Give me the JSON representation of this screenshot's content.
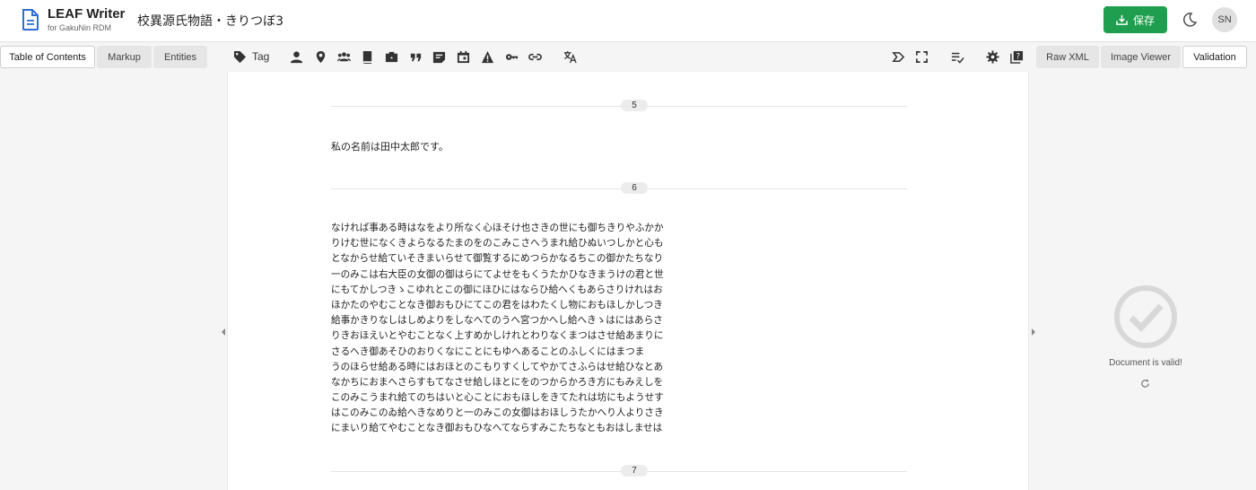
{
  "header": {
    "app_name": "LEAF Writer",
    "app_subtitle": "for GakuNin RDM",
    "document_title": "校異源氏物語・きりつぼ3",
    "save_label": "保存",
    "avatar_initials": "SN"
  },
  "left_tabs": [
    "Table of Contents",
    "Markup",
    "Entities"
  ],
  "toolbar": {
    "tag_label": "Tag",
    "tools": [
      "tag-icon",
      "person-icon",
      "place-icon",
      "organization-icon",
      "title-icon",
      "rs-icon",
      "quote-icon",
      "note-icon",
      "date-icon",
      "correction-icon",
      "key-icon",
      "link-icon",
      "translation-icon",
      "ner-icon",
      "fullscreen-icon",
      "validate-icon",
      "settings-icon",
      "help-icon"
    ]
  },
  "right_tabs": [
    "Raw XML",
    "Image Viewer",
    "Validation"
  ],
  "document": {
    "page_breaks": [
      "5",
      "6",
      "7"
    ],
    "para1": "私の名前は田中太郎です。",
    "para2_lines": [
      "なければ事ある時はなをより所なく心ほそけ也さきの世にも御ちきりやふかか",
      "りけむ世になくきよらなるたまのをのこみこさへうまれ給ひぬいつしかと心も",
      "となからせ給ていそきまいらせて御覧するにめつらかなるちこの御かたちなり",
      "一のみこは右大臣の女御の御はらにてよせをもくうたかひなきまうけの君と世",
      "にもてかしつきゝこゆれとこの御にほひにはならひ給へくもあらさりけれはお",
      "ほかたのやむことなき御おもひにてこの君をはわたくし物におもほしかしつき",
      "給事かきりなしはしめよりをしなへてのうへ宮つかへし給へきゝはにはあらさ",
      "りきおほえいとやむことなく上すめかしけれとわりなくまつはさせ給あまりに",
      "さるへき御あそひのおりくなにことにもゆへあることのふしくにはまつま",
      "うのほらせ給ある時にはおほとのこもりすくしてやかてさふらはせ給ひなとあ",
      "なかちにおまへさらすもてなさせ給しほとにをのつからかろき方にもみえしを",
      "このみこうまれ給てのちはいと心ことにおもほしをきてたれは坊にもようせす",
      "はこのみこのゐ給へきなめりと一のみこの女御はおほしうたかへり人よりさき",
      "にまいり給てやむことなき御おもひなへてならすみこたちなともおはしませは"
    ]
  },
  "validation": {
    "status": "Document is valid!"
  },
  "colors": {
    "save_button": "#1e9e4e",
    "logo": "#2f6fd6"
  }
}
